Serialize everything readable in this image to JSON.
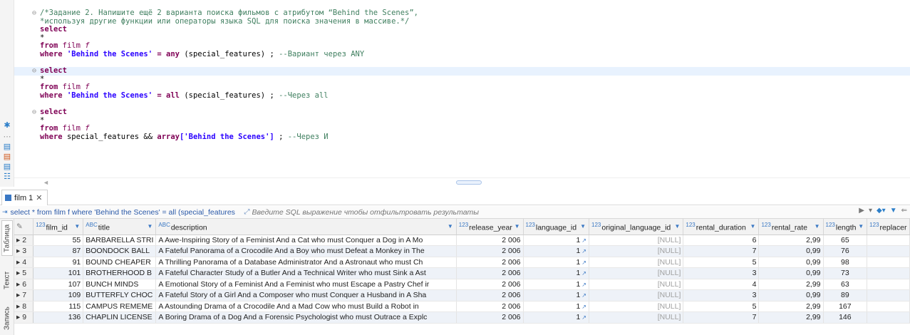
{
  "editor": {
    "comment_line1": "/*Задание 2. Напишите ещё 2 варианта поиска фильмов с атрибутом “Behind the Scenes”,",
    "comment_line2": "*используя другие функции или операторы языка SQL для поиска значения в массиве.*/",
    "q1": {
      "select": "select",
      "star": "*",
      "from": "from",
      "table": "film",
      "alias": "f",
      "where": "where",
      "literal": "'Behind the Scenes'",
      "op": "= any",
      "fn_arg": "(special_features)",
      "semi": ";",
      "comment": "--Вариант через ANY"
    },
    "q2": {
      "select": "select",
      "star": "*",
      "from": "from",
      "table": "film",
      "alias": "f",
      "where": "where",
      "literal": "'Behind the Scenes'",
      "op": "= all",
      "fn_arg": "(special_features)",
      "semi": ";",
      "comment": "--Через all"
    },
    "q3": {
      "select": "select",
      "star": "*",
      "from": "from",
      "table": "film",
      "alias": "f",
      "where": "where",
      "column": "special_features &&",
      "arr": "array",
      "literal": "['Behind the Scenes']",
      "semi": ";",
      "comment": "--Через И"
    }
  },
  "results": {
    "tab_label": "film 1",
    "query_text": "select * from film f where 'Behind the Scenes' = all (special_features",
    "filter_placeholder": "Введите SQL выражение чтобы отфильтровать результаты",
    "side_tabs": [
      "Таблица",
      "Текст",
      "Запись"
    ],
    "columns": [
      {
        "type": "123",
        "name": "film_id"
      },
      {
        "type": "ABC",
        "name": "title"
      },
      {
        "type": "ABC",
        "name": "description"
      },
      {
        "type": "123",
        "name": "release_year"
      },
      {
        "type": "123",
        "name": "language_id"
      },
      {
        "type": "123",
        "name": "original_language_id"
      },
      {
        "type": "123",
        "name": "rental_duration"
      },
      {
        "type": "123",
        "name": "rental_rate"
      },
      {
        "type": "123",
        "name": "length"
      },
      {
        "type": "123",
        "name": "replacer"
      }
    ],
    "rows": [
      {
        "n": "2",
        "film_id": "55",
        "title": "BARBARELLA STRI",
        "description": "A Awe-Inspiring Story of a Feminist And a Cat who must Conquer a Dog in A Mo",
        "release_year": "2 006",
        "language_id": "1",
        "orig": "[NULL]",
        "rental_duration": "6",
        "rental_rate": "2,99",
        "length": "65"
      },
      {
        "n": "3",
        "film_id": "87",
        "title": "BOONDOCK BALL",
        "description": "A Fateful Panorama of a Crocodile And a Boy who must Defeat a Monkey in The",
        "release_year": "2 006",
        "language_id": "1",
        "orig": "[NULL]",
        "rental_duration": "7",
        "rental_rate": "0,99",
        "length": "76"
      },
      {
        "n": "4",
        "film_id": "91",
        "title": "BOUND CHEAPER",
        "description": "A Thrilling Panorama of a Database Administrator And a Astronaut who must Ch",
        "release_year": "2 006",
        "language_id": "1",
        "orig": "[NULL]",
        "rental_duration": "5",
        "rental_rate": "0,99",
        "length": "98"
      },
      {
        "n": "5",
        "film_id": "101",
        "title": "BROTHERHOOD B",
        "description": "A Fateful Character Study of a Butler And a Technical Writer who must Sink a Ast",
        "release_year": "2 006",
        "language_id": "1",
        "orig": "[NULL]",
        "rental_duration": "3",
        "rental_rate": "0,99",
        "length": "73"
      },
      {
        "n": "6",
        "film_id": "107",
        "title": "BUNCH MINDS",
        "description": "A Emotional Story of a Feminist And a Feminist who must Escape a Pastry Chef ir",
        "release_year": "2 006",
        "language_id": "1",
        "orig": "[NULL]",
        "rental_duration": "4",
        "rental_rate": "2,99",
        "length": "63"
      },
      {
        "n": "7",
        "film_id": "109",
        "title": "BUTTERFLY CHOC",
        "description": "A Fateful Story of a Girl And a Composer who must Conquer a Husband in A Sha",
        "release_year": "2 006",
        "language_id": "1",
        "orig": "[NULL]",
        "rental_duration": "3",
        "rental_rate": "0,99",
        "length": "89"
      },
      {
        "n": "8",
        "film_id": "115",
        "title": "CAMPUS REMEME",
        "description": "A Astounding Drama of a Crocodile And a Mad Cow who must Build a Robot in",
        "release_year": "2 006",
        "language_id": "1",
        "orig": "[NULL]",
        "rental_duration": "5",
        "rental_rate": "2,99",
        "length": "167"
      },
      {
        "n": "9",
        "film_id": "136",
        "title": "CHAPLIN LICENSE",
        "description": "A Boring Drama of a Dog And a Forensic Psychologist who must Outrace a Explc",
        "release_year": "2 006",
        "language_id": "1",
        "orig": "[NULL]",
        "rental_duration": "7",
        "rental_rate": "2,99",
        "length": "146"
      }
    ]
  },
  "colors": {
    "keyword": "#7f0055",
    "string": "#2a00ff",
    "comment": "#3f7f5f",
    "current_line": "#e8f2fe",
    "alt_row": "#eef2f8",
    "accent": "#3a78c4"
  }
}
